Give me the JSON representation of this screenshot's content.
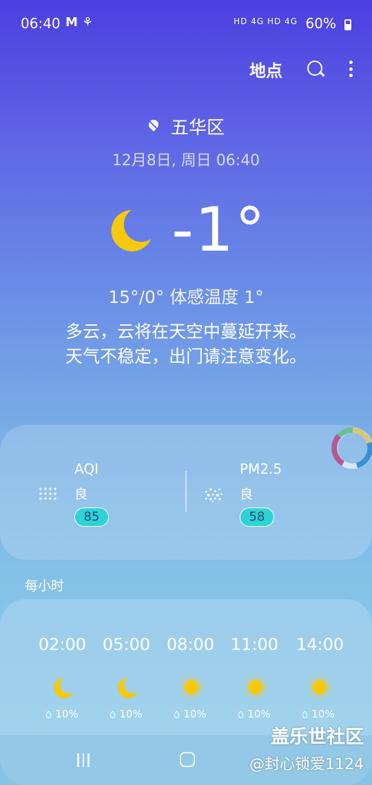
{
  "status_bar": {
    "time": "06:40",
    "left_icons": "M ⚘",
    "signal_text": "HD 4G HD 4G",
    "battery": "60%"
  },
  "header": {
    "locations_label": "地点",
    "search_icon": "search-icon",
    "more_icon": "more-vert-icon"
  },
  "location": {
    "name": "五华区",
    "date_time": "12月8日, 周日 06:40"
  },
  "current": {
    "condition_icon": "moon-icon",
    "temperature": "-1°",
    "hi_lo_feels": "15°/0° 体感温度 1°",
    "description_line1": "多云，云将在天空中蔓延开来。",
    "description_line2": "天气不稳定，出门请注意变化。"
  },
  "air_quality": {
    "aqi": {
      "label": "AQI",
      "level": "良",
      "value": "85"
    },
    "pm25": {
      "label": "PM2.5",
      "level": "良",
      "value": "58"
    },
    "badge_color": "#2ed3d6"
  },
  "hourly": {
    "title": "每小时",
    "items": [
      {
        "time": "02:00",
        "icon": "moon-icon",
        "precip": "10%"
      },
      {
        "time": "05:00",
        "icon": "moon-icon",
        "precip": "10%"
      },
      {
        "time": "08:00",
        "icon": "sun-icon",
        "precip": "10%"
      },
      {
        "time": "11:00",
        "icon": "sun-icon",
        "precip": "10%"
      },
      {
        "time": "14:00",
        "icon": "sun-icon",
        "precip": "10%"
      }
    ]
  },
  "watermark": {
    "line1": "盖乐世社区",
    "line2": "@封心锁爱1124"
  },
  "colors": {
    "icon_yellow": "#f6c90e",
    "gradient_top": "#4b3fe0",
    "gradient_bottom": "#8ecbe9"
  }
}
